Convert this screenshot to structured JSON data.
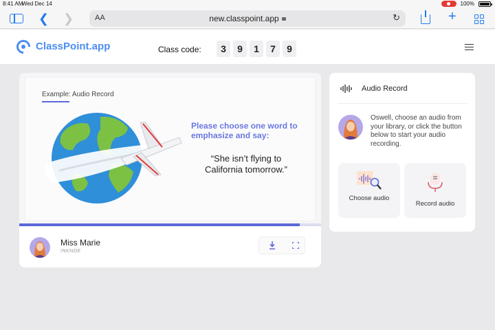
{
  "status_bar": {
    "time": "8:41 AM",
    "date": "Wed Dec 14",
    "battery": "100%"
  },
  "browser": {
    "text_size_label": "AA",
    "url": "new.classpoint.app",
    "icons": [
      "sidebar-icon",
      "back-icon",
      "forward-icon",
      "lock-icon",
      "reload-icon",
      "share-icon",
      "plus-icon",
      "tabs-icon"
    ]
  },
  "header": {
    "brand": "ClassPoint.app",
    "class_code_label": "Class code:",
    "class_code_digits": [
      "3",
      "9",
      "1",
      "7",
      "9"
    ]
  },
  "slide": {
    "tag": "Example: Audio Record",
    "instruction": "Please choose one word to emphasize and say:",
    "quote": "“She isn’t flying to California tomorrow.”",
    "progress": 0.93
  },
  "presenter": {
    "name": "Miss Marie",
    "org": "INKNOE"
  },
  "panel": {
    "title": "Audio Record",
    "message": "Oswell, choose an audio from your library, or click the button below to start your audio recording.",
    "choose_label": "Choose audio",
    "record_label": "Record audio"
  },
  "colors": {
    "accent": "#5a68d8",
    "brand": "#4b8df0",
    "instruction": "#6a78e0",
    "safari_blue": "#1e7cf2"
  }
}
